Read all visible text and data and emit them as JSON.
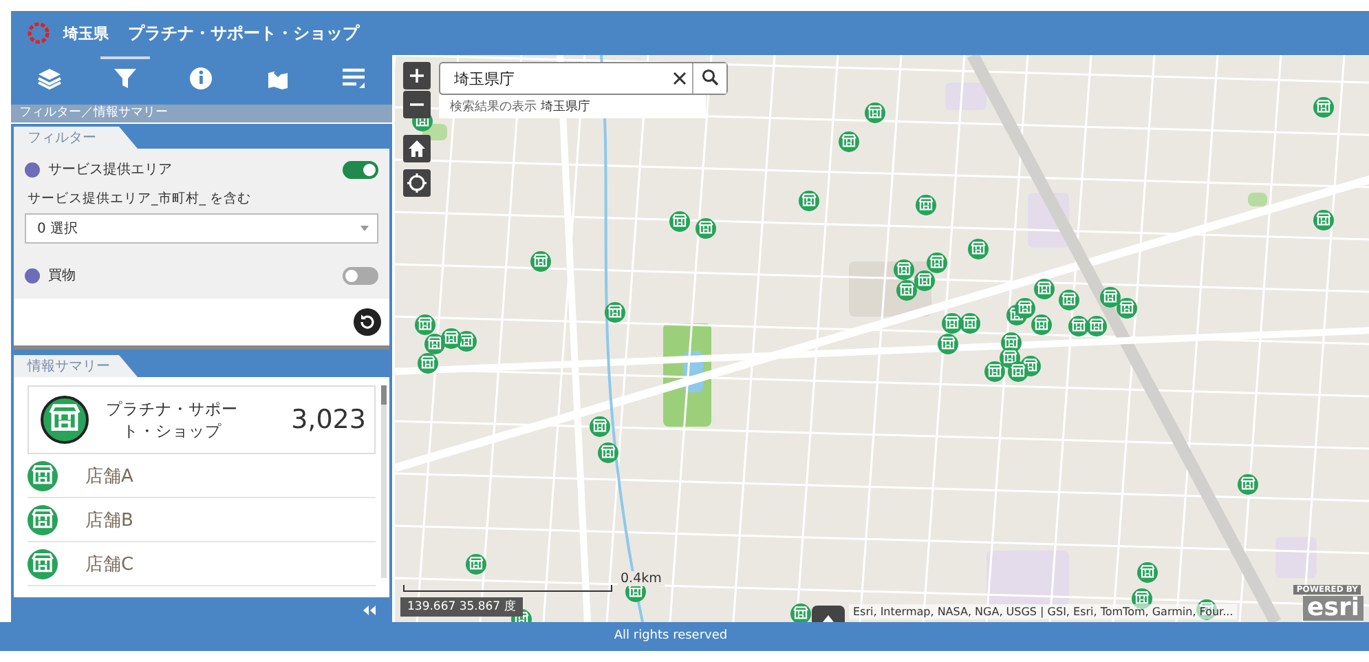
{
  "header": {
    "logo_text": "埼玉県",
    "title": "プラチナ・サポート・ショップ"
  },
  "toolbar": [
    {
      "kind": "layers",
      "selected": false
    },
    {
      "kind": "filter",
      "selected": true
    },
    {
      "kind": "info",
      "selected": false
    },
    {
      "kind": "map",
      "selected": false
    },
    {
      "kind": "list",
      "selected": false
    }
  ],
  "panel_title": "フィルター／情報サマリー",
  "filter": {
    "tab": "フィルター",
    "items": [
      {
        "label": "サービス提供エリア",
        "color": "#6c6cb8",
        "on": true,
        "condition": "サービス提供エリア_市町村_ を含む",
        "select_value": "0 選択"
      },
      {
        "label": "買物",
        "color": "#6c6cb8",
        "on": false
      }
    ]
  },
  "summary": {
    "tab": "情報サマリー",
    "title": "プラチナ・サポート・ショップ",
    "count": "3,023",
    "stores": [
      "店舗A",
      "店舗B",
      "店舗C"
    ]
  },
  "map": {
    "search_value": "埼玉県庁",
    "suggestion": "検索結果の表示 **埼玉県庁**",
    "scale": "0.4km",
    "coordinates": "139.667 35.867 度",
    "attribution": "Esri, Intermap, NASA, NGA, USGS | GSI, Esri, TomTom, Garmin, Four...",
    "powered_by": "POWERED BY",
    "logo": "esri"
  },
  "footer": "All rights reserved"
}
